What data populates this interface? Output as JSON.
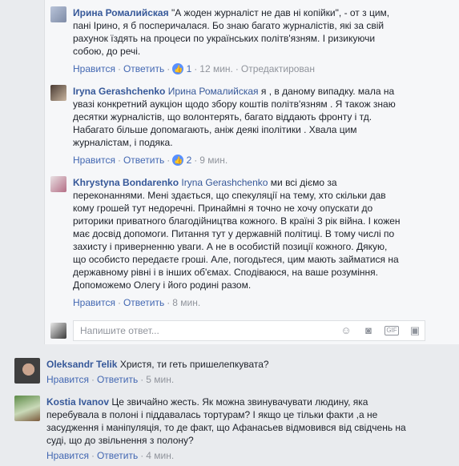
{
  "comments": [
    {
      "author": "Ирина Ромалийская",
      "mention": "",
      "text": "\"А жоден журналіст не дав ні копійки\", - от з цим, пані Ірино, я б посперичалася. Бо знаю багато журналістів, які за свій рахунок їздять на процеси по українських політв'язням. І ризикуючи собою, до речі.",
      "like_label": "Нравится",
      "reply_label": "Ответить",
      "likes": "1",
      "time": "12 мин.",
      "edited": "Отредактирован"
    },
    {
      "author": "Iryna Gerashchenko",
      "mention": "Ирина Ромалийская",
      "text": "я , в даному випадку. мала на увазі конкретний аукціон щодо збору коштів політв'язням . Я також знаю десятки журналістів, що волонтерять, багато віддають фронту і тд. Набагато більше допомагають, аніж деякі іполітики . Хвала цим журналістам, і подяка.",
      "like_label": "Нравится",
      "reply_label": "Ответить",
      "likes": "2",
      "time": "9 мин."
    },
    {
      "author": "Khrystyna Bondarenko",
      "mention": "Iryna Gerashchenko",
      "text": "ми всі діємо за переконаннями. Мені здається, що спекуляції на тему, хто скільки дав кому грошей тут недоречні. Принаймні я точно не хочу опускати до риторики приватного благодійництва кожного. В країні 3 рік війна. І кожен має досвід допомоги. Питання тут у державній політиці. В тому числі по захисту і приверненню уваги. А не в особистій позиції кожного. Дякую, що особисто передаєте гроші. Але, погодьтеся, цим мають займатися на державному рівні і в інших об'ємах. Сподіваюся, на ваше розуміння. Допоможемо Олегу і його родині разом.",
      "like_label": "Нравится",
      "reply_label": "Ответить",
      "time": "8 мин."
    }
  ],
  "reply_placeholder": "Напишите ответ...",
  "top_comments": [
    {
      "author": "Oleksandr Telik",
      "text": "Христя, ти геть пришелепкувата?",
      "like_label": "Нравится",
      "reply_label": "Ответить",
      "time": "5 мин."
    },
    {
      "author": "Kostia Ivanov",
      "text": "Це звичайно жесть. Як можна звинувачувати людину, яка перебувала в полоні і піддавалась тортурам? І якщо це тільки факти ,а не засудження і маніпуляція, то де факт, що Афанасьев відмовився від свідчень на суді, що до звільнення з полону?",
      "like_label": "Нравится",
      "reply_label": "Ответить",
      "time": "4 мин."
    }
  ],
  "icons": [
    "like-icon",
    "emoji-icon",
    "camera-icon",
    "gif-icon",
    "sticker-icon"
  ]
}
